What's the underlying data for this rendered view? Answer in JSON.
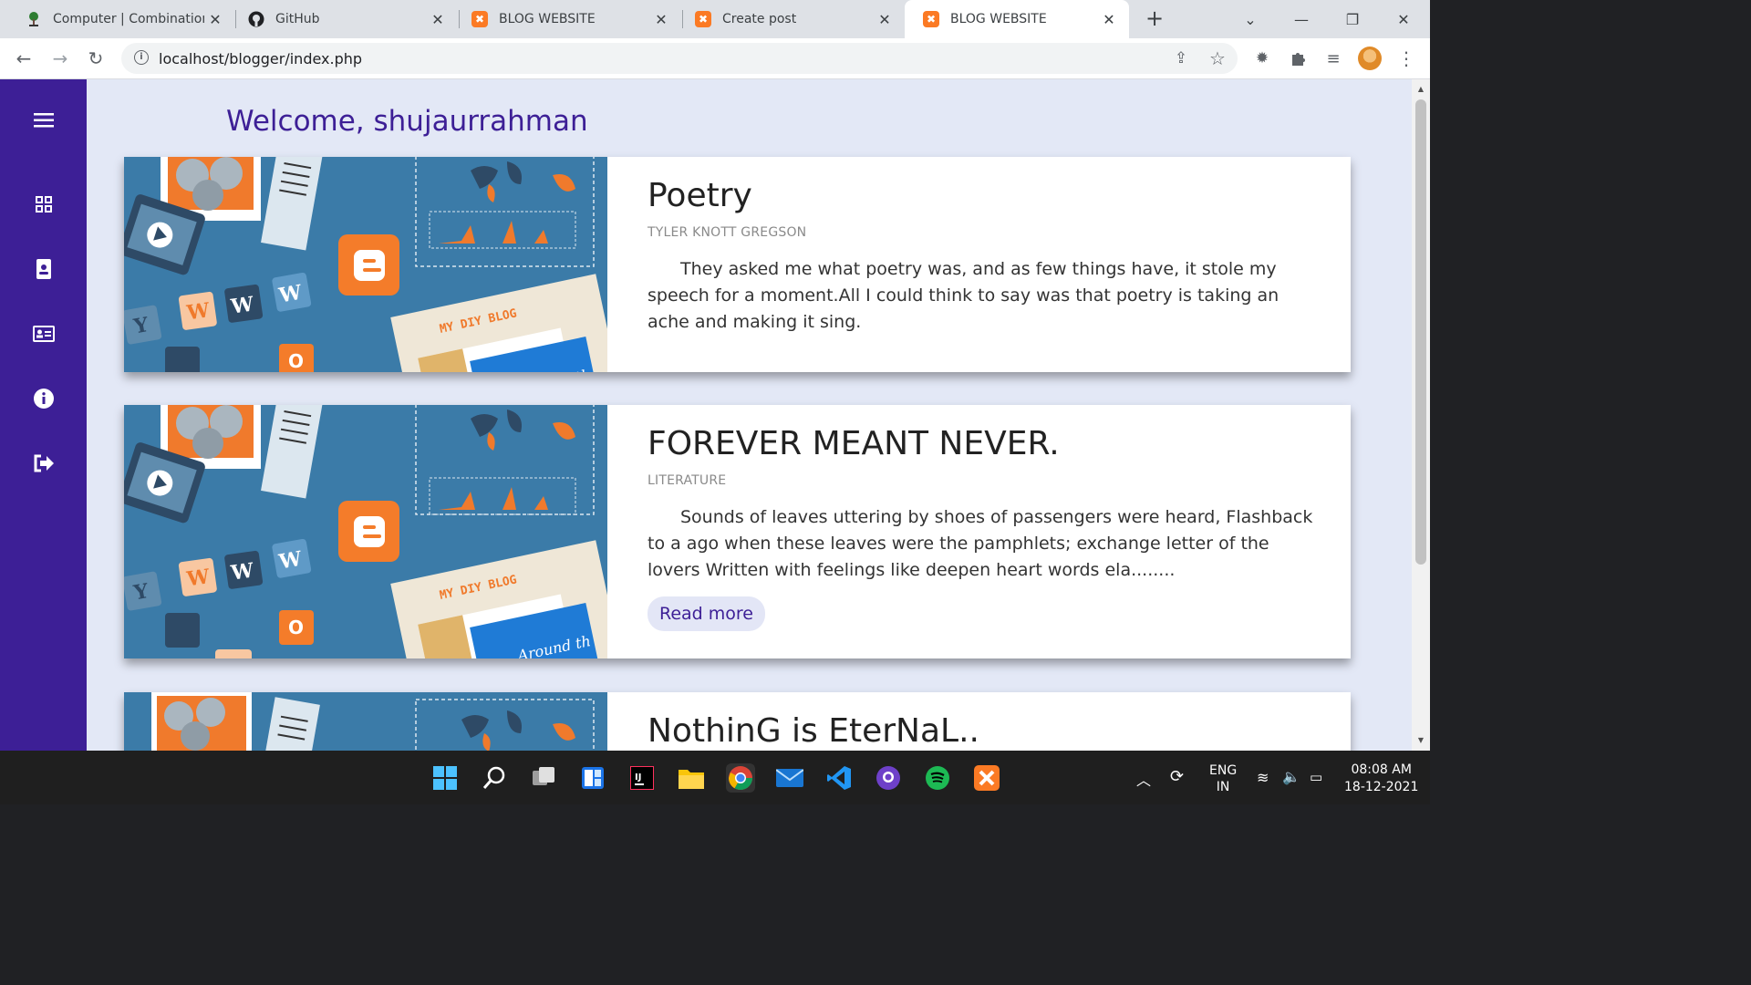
{
  "browser": {
    "tabs": [
      {
        "title": "Computer | Combinationa",
        "icon": "tree-icon"
      },
      {
        "title": "GitHub",
        "icon": "github-icon"
      },
      {
        "title": "BLOG WEBSITE",
        "icon": "xampp-icon"
      },
      {
        "title": "Create post",
        "icon": "xampp-icon"
      },
      {
        "title": "BLOG WEBSITE",
        "icon": "xampp-icon",
        "active": true
      }
    ],
    "url": "localhost/blogger/index.php"
  },
  "page": {
    "welcome": "Welcome, shujaurrahman",
    "sidebar_icons": [
      "menu-icon",
      "dashboard-icon",
      "contact-icon",
      "id-card-icon",
      "info-icon",
      "logout-icon"
    ],
    "posts": [
      {
        "title": "Poetry",
        "category": "TYLER KNOTT GREGSON",
        "text": "They asked me what poetry was, and as few things have, it stole my speech for a moment.All I could think to say was that poetry is taking an ache and making it sing."
      },
      {
        "title": "FOREVER MEANT NEVER.",
        "category": "LITERATURE",
        "text": "Sounds of leaves uttering by shoes of passengers were heard, Flashback to a ago when these leaves were the pamphlets; exchange letter of the lovers Written with feelings like deepen heart words ela........",
        "read_more": "Read more"
      },
      {
        "title": "NothinG is EterNaL.."
      }
    ],
    "image": {
      "blog_sign": "MY DIY BLOG",
      "around_text": "Around th",
      "letters": [
        "Y",
        "W",
        "W",
        "W",
        "O"
      ]
    }
  },
  "taskbar": {
    "language": "ENG",
    "region": "IN",
    "time": "08:08 AM",
    "date": "18-12-2021"
  },
  "colors": {
    "sidebar": "#3d1f96",
    "background": "#e3e8f6",
    "accent": "#fb7a24"
  }
}
